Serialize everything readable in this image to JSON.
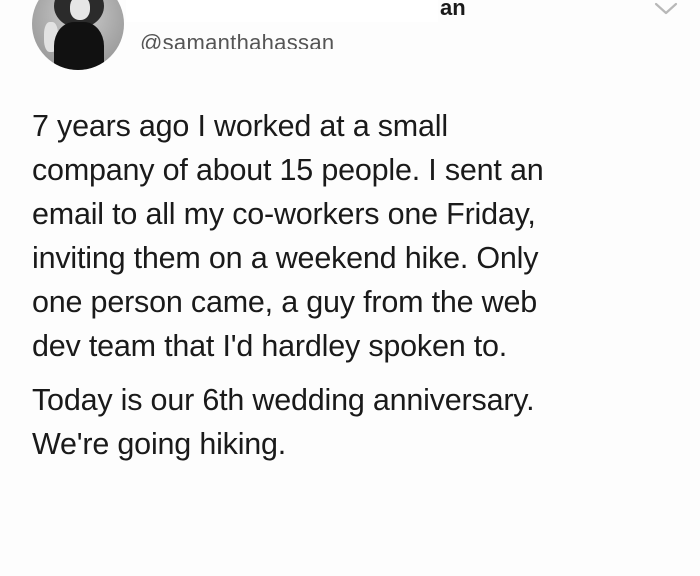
{
  "header": {
    "display_name_tail": "an",
    "handle": "@samanthahassan",
    "menu_icon": "chevron-down-icon",
    "avatar_icon": "avatar"
  },
  "tweet": {
    "paragraph_1": "7 years ago I worked at a small\ncompany of about 15 people. I sent an\nemail to all my co-workers one Friday,\ninviting them on a weekend hike. Only\none person came, a guy from the web\ndev team that I'd hardley spoken to.",
    "paragraph_2": "Today is our 6th wedding anniversary.\nWe're going hiking."
  },
  "colors": {
    "text": "#1a1a1a",
    "handle": "#555555",
    "background": "#fdfdfd"
  }
}
